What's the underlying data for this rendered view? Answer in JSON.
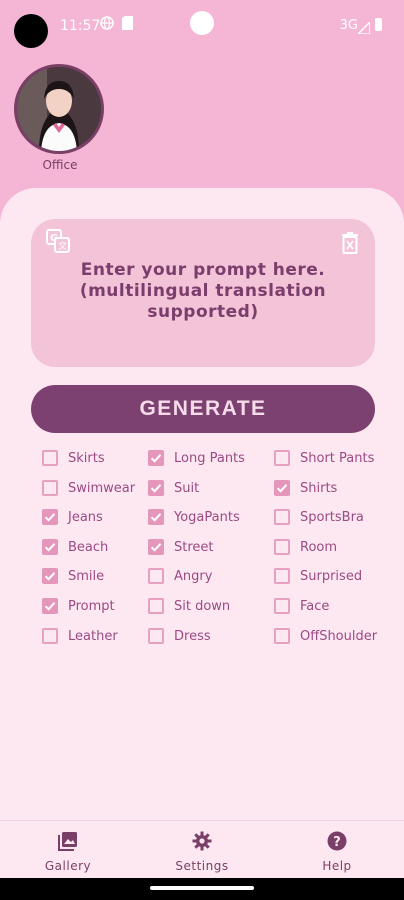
{
  "status_bar": {
    "time": "11:57",
    "network": "3G"
  },
  "avatar": {
    "label": "Office"
  },
  "prompt": {
    "placeholder": "Enter your prompt here. (multilingual translation supported)"
  },
  "generate_label": "GENERATE",
  "options": [
    {
      "label": "Skirts",
      "checked": false
    },
    {
      "label": "Long Pants",
      "checked": true
    },
    {
      "label": "Short Pants",
      "checked": false
    },
    {
      "label": "Swimwear",
      "checked": false
    },
    {
      "label": "Suit",
      "checked": true
    },
    {
      "label": "Shirts",
      "checked": true
    },
    {
      "label": "Jeans",
      "checked": true
    },
    {
      "label": "YogaPants",
      "checked": true
    },
    {
      "label": "SportsBra",
      "checked": false
    },
    {
      "label": "Beach",
      "checked": true
    },
    {
      "label": "Street",
      "checked": true
    },
    {
      "label": "Room",
      "checked": false
    },
    {
      "label": "Smile",
      "checked": true
    },
    {
      "label": "Angry",
      "checked": false
    },
    {
      "label": "Surprised",
      "checked": false
    },
    {
      "label": "Prompt",
      "checked": true
    },
    {
      "label": "Sit down",
      "checked": false
    },
    {
      "label": "Face",
      "checked": false
    },
    {
      "label": "Leather",
      "checked": false
    },
    {
      "label": "Dress",
      "checked": false
    },
    {
      "label": "OffShoulder",
      "checked": false
    }
  ],
  "nav": {
    "gallery": "Gallery",
    "settings": "Settings",
    "help": "Help"
  },
  "colors": {
    "accent": "#7c4171",
    "header_pink": "#f4b6d4",
    "sheet_bg": "#fde8f2",
    "checkbox_on": "#e496bb"
  }
}
